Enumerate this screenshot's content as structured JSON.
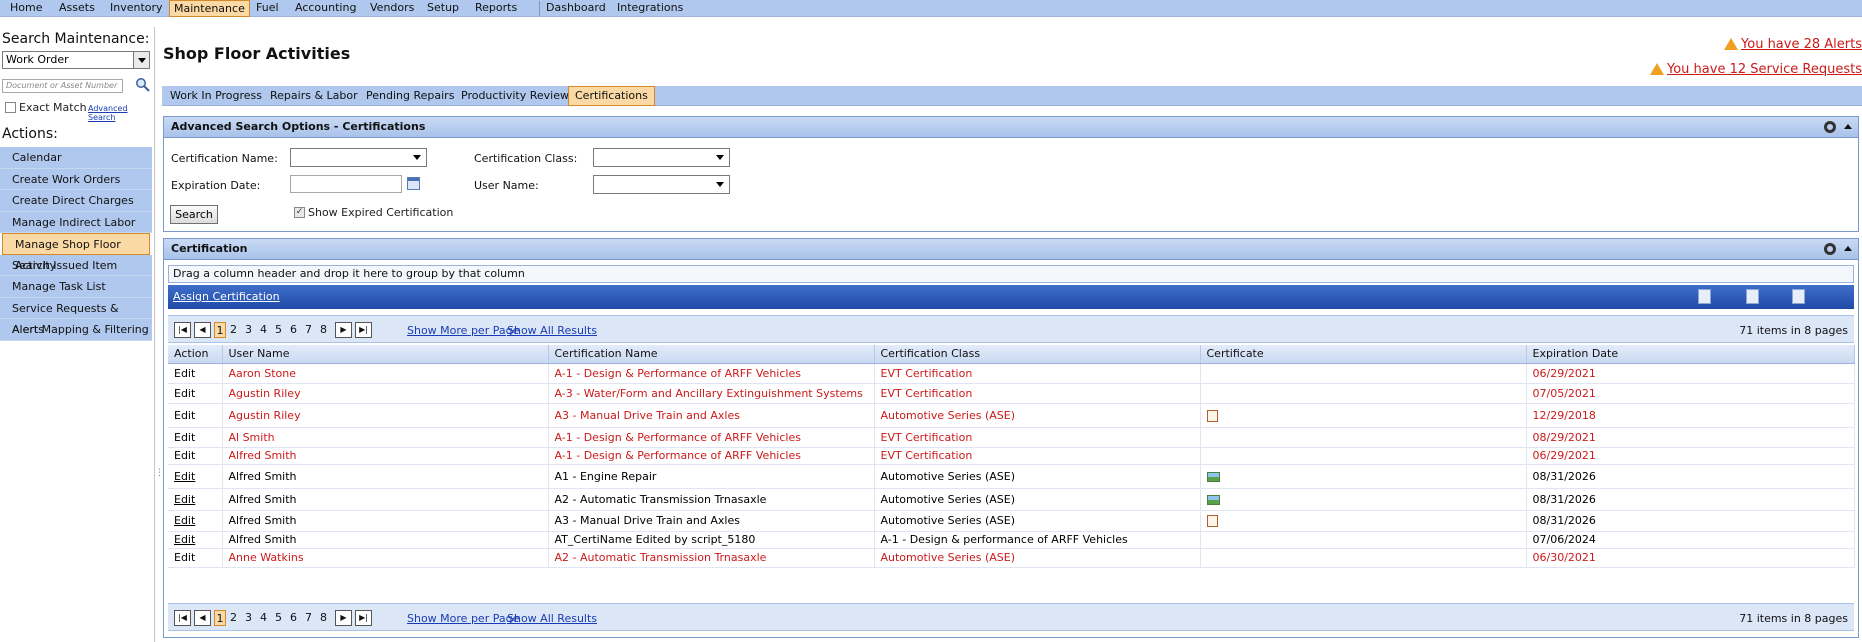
{
  "top_menu": {
    "items": [
      "Home",
      "Assets",
      "Inventory",
      "Maintenance",
      "Fuel",
      "Accounting",
      "Vendors",
      "Setup",
      "Reports",
      "Dashboard",
      "Integrations"
    ],
    "active": "Maintenance"
  },
  "sidebar": {
    "search_title": "Search Maintenance:",
    "search_type": "Work Order",
    "doc_placeholder": "Document or Asset Number",
    "exact_match": "Exact Match",
    "advanced_search": "Advanced Search",
    "actions_title": "Actions:",
    "actions": [
      "Calendar",
      "Create Work Orders",
      "Create Direct Charges",
      "Manage Indirect Labor",
      "Manage Shop Floor Activity",
      "Search Issued Item",
      "Manage Task List",
      "Service Requests & Alerts",
      "Alert Mapping & Filtering"
    ],
    "active_action": "Manage Shop Floor Activity"
  },
  "header": {
    "title": "Shop Floor Activities",
    "alert1": "You have 28 Alerts",
    "alert2": "You have 12 Service Requests"
  },
  "tabs": {
    "items": [
      "Work In Progress",
      "Repairs & Labor",
      "Pending Repairs",
      "Productivity Review",
      "Certifications"
    ],
    "active": "Certifications"
  },
  "advanced_search": {
    "title": "Advanced Search Options - Certifications",
    "cert_name_label": "Certification Name:",
    "cert_class_label": "Certification Class:",
    "exp_date_label": "Expiration Date:",
    "user_name_label": "User Name:",
    "search_button": "Search",
    "show_expired": "Show Expired Certification",
    "show_expired_checked": true
  },
  "certification": {
    "title": "Certification",
    "group_hint": "Drag a column header and drop it here to group by that column",
    "assign_link": "Assign Certification",
    "pager": {
      "pages": [
        "1",
        "2",
        "3",
        "4",
        "5",
        "6",
        "7",
        "8"
      ],
      "current": "1",
      "show_more": "Show More per Page",
      "show_all": "Show All Results",
      "info": "71 items in 8 pages"
    },
    "columns": [
      "Action",
      "User Name",
      "Certification Name",
      "Certification Class",
      "Certificate",
      "Expiration Date"
    ],
    "rows": [
      {
        "action": "Edit",
        "user": "Aaron Stone",
        "cert_name": "A-1 - Design & Performance of ARFF Vehicles",
        "cert_class": "EVT Certification",
        "certificate": "",
        "expiration": "06/29/2021",
        "expired": true
      },
      {
        "action": "Edit",
        "user": "Agustin Riley",
        "cert_name": "A-3 - Water/Form and Ancillary Extinguishment Systems",
        "cert_class": "EVT Certification",
        "certificate": "",
        "expiration": "07/05/2021",
        "expired": true
      },
      {
        "action": "Edit",
        "user": "Agustin Riley",
        "cert_name": "A3 - Manual Drive Train and Axles",
        "cert_class": "Automotive Series (ASE)",
        "certificate": "doc-icon",
        "expiration": "12/29/2018",
        "expired": true
      },
      {
        "action": "Edit",
        "user": "Al Smith",
        "cert_name": "A-1 - Design & Performance of ARFF Vehicles",
        "cert_class": "EVT Certification",
        "certificate": "",
        "expiration": "08/29/2021",
        "expired": true
      },
      {
        "action": "Edit",
        "user": "Alfred Smith",
        "cert_name": "A-1 - Design & Performance of ARFF Vehicles",
        "cert_class": "EVT Certification",
        "certificate": "",
        "expiration": "06/29/2021",
        "expired": true
      },
      {
        "action": "Edit",
        "user": "Alfred Smith",
        "cert_name": "A1 - Engine Repair",
        "cert_class": "Automotive Series (ASE)",
        "certificate": "image-icon",
        "expiration": "08/31/2026",
        "expired": false
      },
      {
        "action": "Edit",
        "user": "Alfred Smith",
        "cert_name": "A2 - Automatic Transmission Trnasaxle",
        "cert_class": "Automotive Series (ASE)",
        "certificate": "image-icon",
        "expiration": "08/31/2026",
        "expired": false
      },
      {
        "action": "Edit",
        "user": "Alfred Smith",
        "cert_name": "A3 - Manual Drive Train and Axles",
        "cert_class": "Automotive Series (ASE)",
        "certificate": "doc-icon",
        "expiration": "08/31/2026",
        "expired": false
      },
      {
        "action": "Edit",
        "user": "Alfred Smith",
        "cert_name": "AT_CertiName Edited by script_5180",
        "cert_class": "A-1 - Design & performance of ARFF Vehicles",
        "certificate": "",
        "expiration": "07/06/2024",
        "expired": false
      },
      {
        "action": "Edit",
        "user": "Anne Watkins",
        "cert_name": "A2 - Automatic Transmission Trnasaxle",
        "cert_class": "Automotive Series (ASE)",
        "certificate": "",
        "expiration": "06/30/2021",
        "expired": true
      }
    ]
  }
}
